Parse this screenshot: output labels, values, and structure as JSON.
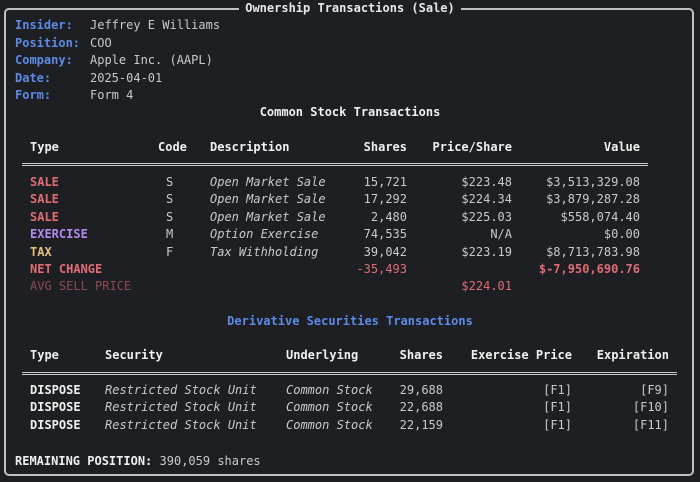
{
  "title": "Ownership Transactions (Sale)",
  "info": [
    {
      "label": "Insider:",
      "value": "Jeffrey E Williams"
    },
    {
      "label": "Position:",
      "value": "COO"
    },
    {
      "label": "Company:",
      "value": "Apple Inc. (AAPL)"
    },
    {
      "label": "Date:",
      "value": "2025-04-01"
    },
    {
      "label": "Form:",
      "value": "Form 4"
    }
  ],
  "common": {
    "title": "Common Stock Transactions",
    "headers": [
      "Type",
      "Code",
      "Description",
      "Shares",
      "Price/Share",
      "Value"
    ],
    "rows": [
      {
        "type": "SALE",
        "code": "S",
        "description": "Open Market Sale",
        "shares": "15,721",
        "price": "$223.48",
        "value": "$3,513,329.08",
        "color": "#e06c75"
      },
      {
        "type": "SALE",
        "code": "S",
        "description": "Open Market Sale",
        "shares": "17,292",
        "price": "$224.34",
        "value": "$3,879,287.28",
        "color": "#e06c75"
      },
      {
        "type": "SALE",
        "code": "S",
        "description": "Open Market Sale",
        "shares": "2,480",
        "price": "$225.03",
        "value": "$558,074.40",
        "color": "#e06c75"
      },
      {
        "type": "EXERCISE",
        "code": "M",
        "description": "Option Exercise",
        "shares": "74,535",
        "price": "N/A",
        "value": "$0.00",
        "color": "#b08cf0"
      },
      {
        "type": "TAX",
        "code": "F",
        "description": "Tax Withholding",
        "shares": "39,042",
        "price": "$223.19",
        "value": "$8,713,783.98",
        "color": "#e5c07b"
      }
    ],
    "net_change": {
      "label": "NET CHANGE",
      "shares": "-35,493",
      "value": "$-7,950,690.76"
    },
    "avg_sell": {
      "label": "AVG SELL PRICE",
      "price": "$224.01"
    }
  },
  "derivative": {
    "title": "Derivative Securities Transactions",
    "headers": [
      "Type",
      "Security",
      "Underlying",
      "Shares",
      "Exercise Price",
      "Expiration"
    ],
    "rows": [
      {
        "type": "DISPOSE",
        "security": "Restricted Stock Unit",
        "underlying": "Common Stock",
        "shares": "29,688",
        "exercise_price": "[F1]",
        "expiration": "[F9]"
      },
      {
        "type": "DISPOSE",
        "security": "Restricted Stock Unit",
        "underlying": "Common Stock",
        "shares": "22,688",
        "exercise_price": "[F1]",
        "expiration": "[F10]"
      },
      {
        "type": "DISPOSE",
        "security": "Restricted Stock Unit",
        "underlying": "Common Stock",
        "shares": "22,159",
        "exercise_price": "[F1]",
        "expiration": "[F11]"
      }
    ]
  },
  "remaining": {
    "label": "REMAINING POSITION:",
    "value": "390,059 shares"
  },
  "colors": {
    "label": "#5c8ae6",
    "negative": "#e06c75",
    "avg_dim": "#8c4b52",
    "derivative_title": "#5c8ae6"
  }
}
